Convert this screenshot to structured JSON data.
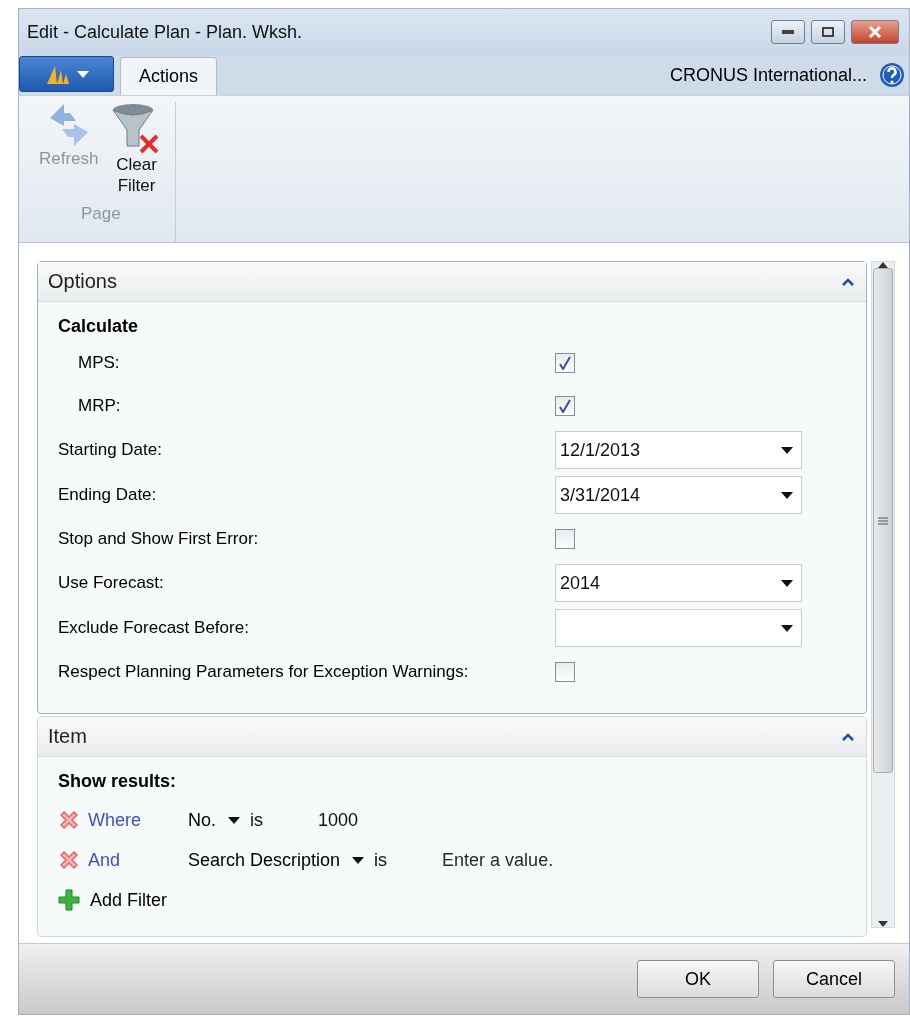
{
  "window": {
    "title": "Edit - Calculate Plan - Plan. Wksh."
  },
  "tabs": [
    {
      "label": "Actions",
      "selected": true
    }
  ],
  "company": "CRONUS International...",
  "ribbon": {
    "actions": [
      {
        "label": "Refresh",
        "kind": "refresh",
        "disabled": true
      },
      {
        "label": "Clear\nFilter",
        "kind": "clear-filter",
        "disabled": false
      }
    ],
    "group": "Page"
  },
  "options": {
    "title": "Options",
    "expanded": true,
    "section": "Calculate",
    "fields": [
      {
        "label": "MPS:",
        "kind": "checkbox",
        "checked": true,
        "indent": true
      },
      {
        "label": "MRP:",
        "kind": "checkbox",
        "checked": true,
        "indent": true
      },
      {
        "label": "Starting Date:",
        "kind": "dropdown",
        "value": "12/1/2013"
      },
      {
        "label": "Ending Date:",
        "kind": "dropdown",
        "value": "3/31/2014"
      },
      {
        "label": "Stop and Show First Error:",
        "kind": "checkbox",
        "checked": false
      },
      {
        "label": "Use Forecast:",
        "kind": "dropdown",
        "value": "2014"
      },
      {
        "label": "Exclude Forecast Before:",
        "kind": "dropdown"
      },
      {
        "label": "Respect Planning Parameters for Exception Warnings:",
        "kind": "checkbox",
        "checked": false
      }
    ]
  },
  "item": {
    "title": "Item",
    "expanded": true,
    "heading": "Show results:",
    "filters": [
      {
        "join": "Where",
        "field": "No.",
        "operator": "is",
        "value": "1000"
      },
      {
        "join": "And",
        "field": "Search Description",
        "operator": "is",
        "placeholder": "Enter a value."
      }
    ],
    "add": "Add Filter"
  },
  "buttons": [
    "OK",
    "Cancel"
  ]
}
